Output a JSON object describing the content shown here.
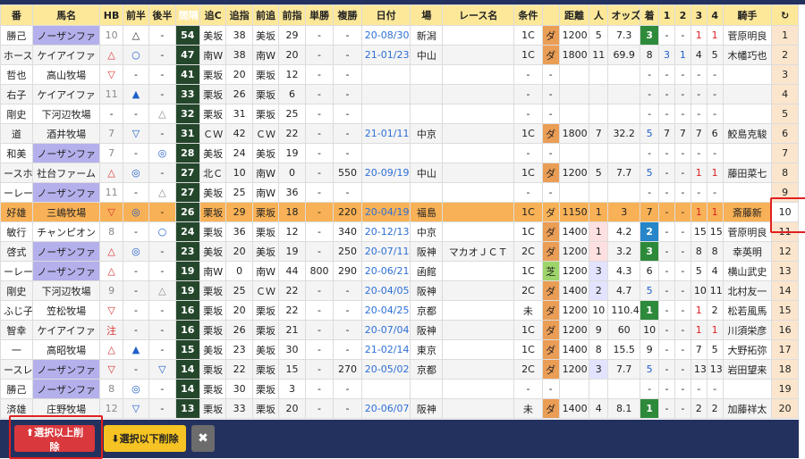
{
  "headers": [
    "番",
    "馬名",
    "HB",
    "前半",
    "後半",
    "間隔",
    "追C",
    "追指",
    "前追",
    "前指",
    "単勝",
    "複勝",
    "日付",
    "場",
    "レース名",
    "条件",
    "",
    "距離",
    "人",
    "オッズ",
    "着",
    "1",
    "2",
    "3",
    "4",
    "騎手",
    "↻"
  ],
  "rows": [
    {
      "no": "勝己",
      "horse": "ノーザンファ",
      "horse_hl": true,
      "hb": "10",
      "zen": "△",
      "kou": "-",
      "interval": "54",
      "oic": "美坂",
      "oishi": "38",
      "zenoi": "美坂",
      "zenshi": "29",
      "tan": "-",
      "fuku": "-",
      "date": "20-08/30",
      "place": "新潟",
      "race": "",
      "cond": "1C",
      "surf": "ダ",
      "dist": "1200",
      "pop": "5",
      "odds": "7.3",
      "fin": "3",
      "c1": "-",
      "c2": "-",
      "c3": "1",
      "c4": "1",
      "jockey": "菅原明良",
      "idx": "1"
    },
    {
      "no": "ホース",
      "horse": "ケイアイファ",
      "horse_hl": false,
      "hb": "△",
      "zen": "○",
      "kou": "-",
      "interval": "47",
      "oic": "南W",
      "oishi": "38",
      "zenoi": "南W",
      "zenshi": "20",
      "tan": "-",
      "fuku": "-",
      "date": "21-01/23",
      "place": "中山",
      "race": "",
      "cond": "1C",
      "surf": "ダ",
      "dist": "1800",
      "pop": "11",
      "odds": "69.9",
      "fin": "8",
      "c1": "3",
      "c2": "1",
      "c3": "4",
      "c4": "5",
      "jockey": "木幡巧也",
      "idx": "2"
    },
    {
      "no": "哲也",
      "horse": "高山牧場",
      "horse_hl": false,
      "hb": "▽",
      "zen": "-",
      "kou": "-",
      "interval": "41",
      "oic": "栗坂",
      "oishi": "20",
      "zenoi": "栗坂",
      "zenshi": "12",
      "tan": "-",
      "fuku": "-",
      "date": "",
      "place": "",
      "race": "",
      "cond": "-",
      "surf": "-",
      "dist": "",
      "pop": "",
      "odds": "",
      "fin": "-",
      "c1": "-",
      "c2": "-",
      "c3": "-",
      "c4": "-",
      "jockey": "",
      "idx": "3"
    },
    {
      "no": "右子",
      "horse": "ケイアイファ",
      "horse_hl": false,
      "hb": "11",
      "zen": "▲",
      "kou": "-",
      "interval": "33",
      "oic": "栗坂",
      "oishi": "26",
      "zenoi": "栗坂",
      "zenshi": "6",
      "tan": "-",
      "fuku": "-",
      "date": "",
      "place": "",
      "race": "",
      "cond": "-",
      "surf": "-",
      "dist": "",
      "pop": "",
      "odds": "",
      "fin": "-",
      "c1": "-",
      "c2": "-",
      "c3": "-",
      "c4": "-",
      "jockey": "",
      "idx": "4"
    },
    {
      "no": "剛史",
      "horse": "下河辺牧場",
      "horse_hl": false,
      "hb": "-",
      "zen": "-",
      "kou": "△",
      "interval": "32",
      "oic": "栗坂",
      "oishi": "31",
      "zenoi": "栗坂",
      "zenshi": "25",
      "tan": "-",
      "fuku": "-",
      "date": "",
      "place": "",
      "race": "",
      "cond": "-",
      "surf": "-",
      "dist": "",
      "pop": "",
      "odds": "",
      "fin": "-",
      "c1": "-",
      "c2": "-",
      "c3": "-",
      "c4": "-",
      "jockey": "",
      "idx": "5"
    },
    {
      "no": "道",
      "horse": "酒井牧場",
      "horse_hl": false,
      "hb": "7",
      "zen": "▽",
      "kou": "-",
      "interval": "31",
      "oic": "ＣＷ",
      "oishi": "42",
      "zenoi": "ＣＷ",
      "zenshi": "22",
      "tan": "-",
      "fuku": "-",
      "date": "21-01/11",
      "place": "中京",
      "race": "",
      "cond": "1C",
      "surf": "ダ",
      "dist": "1800",
      "pop": "7",
      "odds": "32.2",
      "fin": "5",
      "c1": "7",
      "c2": "7",
      "c3": "7",
      "c4": "6",
      "jockey": "鮫島克駿",
      "idx": "6"
    },
    {
      "no": "和美",
      "horse": "ノーザンファ",
      "horse_hl": true,
      "hb": "7",
      "zen": "-",
      "kou": "◎",
      "interval": "28",
      "oic": "美坂",
      "oishi": "24",
      "zenoi": "美坂",
      "zenshi": "19",
      "tan": "-",
      "fuku": "-",
      "date": "",
      "place": "",
      "race": "",
      "cond": "-",
      "surf": "-",
      "dist": "",
      "pop": "",
      "odds": "",
      "fin": "-",
      "c1": "-",
      "c2": "-",
      "c3": "-",
      "c4": "-",
      "jockey": "",
      "idx": "7"
    },
    {
      "no": "ースホ",
      "horse": "社台ファーム",
      "horse_hl": false,
      "hb": "△",
      "zen": "◎",
      "kou": "-",
      "interval": "27",
      "oic": "北Ｃ",
      "oishi": "10",
      "zenoi": "南W",
      "zenshi": "0",
      "tan": "-",
      "fuku": "550",
      "date": "20-09/19",
      "place": "中山",
      "race": "",
      "cond": "1C",
      "surf": "ダ",
      "dist": "1200",
      "pop": "5",
      "odds": "7.7",
      "fin": "5",
      "c1": "-",
      "c2": "-",
      "c3": "1",
      "c4": "1",
      "jockey": "藤田菜七",
      "idx": "8"
    },
    {
      "no": "ーレー",
      "horse": "ノーザンファ",
      "horse_hl": true,
      "hb": "11",
      "zen": "-",
      "kou": "△",
      "interval": "27",
      "oic": "美坂",
      "oishi": "25",
      "zenoi": "南W",
      "zenshi": "36",
      "tan": "-",
      "fuku": "-",
      "date": "",
      "place": "",
      "race": "",
      "cond": "-",
      "surf": "-",
      "dist": "",
      "pop": "",
      "odds": "",
      "fin": "-",
      "c1": "-",
      "c2": "-",
      "c3": "-",
      "c4": "-",
      "jockey": "",
      "idx": "9"
    },
    {
      "no": "好雄",
      "horse": "三嶋牧場",
      "horse_hl": false,
      "hb": "▽",
      "zen": "◎",
      "kou": "-",
      "interval": "26",
      "oic": "栗坂",
      "oishi": "29",
      "zenoi": "栗坂",
      "zenshi": "18",
      "tan": "-",
      "fuku": "220",
      "date": "20-04/19",
      "place": "福島",
      "race": "",
      "cond": "1C",
      "surf": "ダ",
      "dist": "1150",
      "pop": "1",
      "odds": "3",
      "fin": "7",
      "c1": "-",
      "c2": "-",
      "c3": "1",
      "c4": "1",
      "jockey": "斎藤新",
      "idx": "10",
      "hl": true
    },
    {
      "no": "敏行",
      "horse": "チャンピオン",
      "horse_hl": false,
      "hb": "8",
      "zen": "-",
      "kou": "○",
      "interval": "24",
      "oic": "栗坂",
      "oishi": "36",
      "zenoi": "栗坂",
      "zenshi": "12",
      "tan": "-",
      "fuku": "340",
      "date": "20-12/13",
      "place": "中京",
      "race": "",
      "cond": "1C",
      "surf": "ダ",
      "dist": "1400",
      "pop": "1",
      "odds": "4.2",
      "fin": "2",
      "c1": "-",
      "c2": "-",
      "c3": "15",
      "c4": "15",
      "jockey": "菅原明良",
      "idx": "11"
    },
    {
      "no": "啓式",
      "horse": "ノーザンファ",
      "horse_hl": true,
      "hb": "△",
      "zen": "◎",
      "kou": "-",
      "interval": "23",
      "oic": "美坂",
      "oishi": "20",
      "zenoi": "美坂",
      "zenshi": "19",
      "tan": "-",
      "fuku": "250",
      "date": "20-07/11",
      "place": "阪神",
      "race": "マカオＪＣＴ",
      "cond": "2C",
      "surf": "ダ",
      "dist": "1200",
      "pop": "1",
      "odds": "3.2",
      "fin": "3",
      "c1": "-",
      "c2": "-",
      "c3": "8",
      "c4": "8",
      "jockey": "幸英明",
      "idx": "12"
    },
    {
      "no": "ーレー",
      "horse": "ノーザンファ",
      "horse_hl": true,
      "hb": "△",
      "zen": "-",
      "kou": "-",
      "interval": "19",
      "oic": "南W",
      "oishi": "0",
      "zenoi": "南W",
      "zenshi": "44",
      "tan": "800",
      "fuku": "290",
      "date": "20-06/21",
      "place": "函館",
      "race": "",
      "cond": "1C",
      "surf": "芝",
      "dist": "1200",
      "pop": "3",
      "odds": "4.3",
      "fin": "6",
      "c1": "-",
      "c2": "-",
      "c3": "5",
      "c4": "4",
      "jockey": "横山武史",
      "idx": "13"
    },
    {
      "no": "剛史",
      "horse": "下河辺牧場",
      "horse_hl": false,
      "hb": "9",
      "zen": "-",
      "kou": "△",
      "interval": "19",
      "oic": "栗坂",
      "oishi": "25",
      "zenoi": "ＣＷ",
      "zenshi": "22",
      "tan": "-",
      "fuku": "-",
      "date": "20-04/05",
      "place": "阪神",
      "race": "",
      "cond": "2C",
      "surf": "ダ",
      "dist": "1400",
      "pop": "2",
      "odds": "4.7",
      "fin": "5",
      "c1": "-",
      "c2": "-",
      "c3": "10",
      "c4": "11",
      "jockey": "北村友一",
      "idx": "14"
    },
    {
      "no": "ふじ子",
      "horse": "笠松牧場",
      "horse_hl": false,
      "hb": "▽",
      "zen": "-",
      "kou": "-",
      "interval": "16",
      "oic": "栗坂",
      "oishi": "20",
      "zenoi": "栗坂",
      "zenshi": "22",
      "tan": "-",
      "fuku": "-",
      "date": "20-04/25",
      "place": "京都",
      "race": "",
      "cond": "未",
      "surf": "ダ",
      "dist": "1200",
      "pop": "10",
      "odds": "110.4",
      "fin": "1",
      "c1": "-",
      "c2": "-",
      "c3": "1",
      "c4": "2",
      "jockey": "松若風馬",
      "idx": "15"
    },
    {
      "no": "智幸",
      "horse": "ケイアイファ",
      "horse_hl": false,
      "hb": "注",
      "zen": "-",
      "kou": "-",
      "interval": "16",
      "oic": "栗坂",
      "oishi": "26",
      "zenoi": "栗坂",
      "zenshi": "21",
      "tan": "-",
      "fuku": "-",
      "date": "20-07/04",
      "place": "阪神",
      "race": "",
      "cond": "1C",
      "surf": "ダ",
      "dist": "1200",
      "pop": "9",
      "odds": "60",
      "fin": "10",
      "c1": "-",
      "c2": "-",
      "c3": "1",
      "c4": "1",
      "jockey": "川須栄彦",
      "idx": "16"
    },
    {
      "no": "一",
      "horse": "高昭牧場",
      "horse_hl": false,
      "hb": "△",
      "zen": "▲",
      "kou": "-",
      "interval": "15",
      "oic": "美坂",
      "oishi": "23",
      "zenoi": "美坂",
      "zenshi": "30",
      "tan": "-",
      "fuku": "-",
      "date": "21-02/14",
      "place": "東京",
      "race": "",
      "cond": "1C",
      "surf": "ダ",
      "dist": "1400",
      "pop": "8",
      "odds": "15.5",
      "fin": "9",
      "c1": "-",
      "c2": "-",
      "c3": "7",
      "c4": "5",
      "jockey": "大野拓弥",
      "idx": "17"
    },
    {
      "no": "ースレ",
      "horse": "ノーザンファ",
      "horse_hl": true,
      "hb": "▽",
      "zen": "-",
      "kou": "▽",
      "interval": "14",
      "oic": "栗坂",
      "oishi": "22",
      "zenoi": "栗坂",
      "zenshi": "15",
      "tan": "-",
      "fuku": "270",
      "date": "20-05/02",
      "place": "京都",
      "race": "",
      "cond": "2C",
      "surf": "ダ",
      "dist": "1200",
      "pop": "3",
      "odds": "7.7",
      "fin": "5",
      "c1": "-",
      "c2": "-",
      "c3": "13",
      "c4": "13",
      "jockey": "岩田望来",
      "idx": "18"
    },
    {
      "no": "勝己",
      "horse": "ノーザンファ",
      "horse_hl": true,
      "hb": "8",
      "zen": "◎",
      "kou": "-",
      "interval": "14",
      "oic": "栗坂",
      "oishi": "30",
      "zenoi": "栗坂",
      "zenshi": "3",
      "tan": "-",
      "fuku": "-",
      "date": "",
      "place": "",
      "race": "",
      "cond": "-",
      "surf": "-",
      "dist": "",
      "pop": "",
      "odds": "",
      "fin": "-",
      "c1": "-",
      "c2": "-",
      "c3": "-",
      "c4": "-",
      "jockey": "",
      "idx": "19"
    },
    {
      "no": "済雄",
      "horse": "庄野牧場",
      "horse_hl": false,
      "hb": "12",
      "zen": "▽",
      "kou": "-",
      "interval": "13",
      "oic": "栗坂",
      "oishi": "33",
      "zenoi": "栗坂",
      "zenshi": "20",
      "tan": "-",
      "fuku": "-",
      "date": "20-06/07",
      "place": "阪神",
      "race": "",
      "cond": "未",
      "surf": "ダ",
      "dist": "1400",
      "pop": "4",
      "odds": "8.1",
      "fin": "1",
      "c1": "-",
      "c2": "-",
      "c3": "2",
      "c4": "2",
      "jockey": "加藤祥太",
      "idx": "20"
    }
  ],
  "buttons": {
    "delete_above": "⬆選択以上削除",
    "delete_below": "⬇選択以下削除",
    "close": "✖"
  }
}
